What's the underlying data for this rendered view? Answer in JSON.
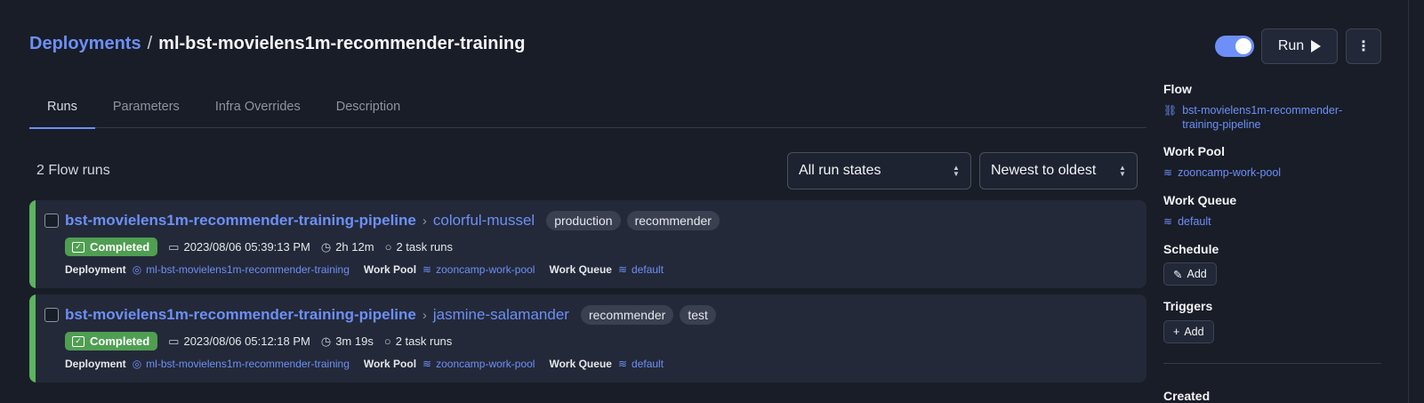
{
  "header": {
    "breadcrumb_root": "Deployments",
    "breadcrumb_sep": "/",
    "breadcrumb_current": "ml-bst-movielens1m-recommender-training",
    "run_label": "Run",
    "menu_glyph": "⋮"
  },
  "tabs": [
    {
      "label": "Runs",
      "active": true
    },
    {
      "label": "Parameters",
      "active": false
    },
    {
      "label": "Infra Overrides",
      "active": false
    },
    {
      "label": "Description",
      "active": false
    }
  ],
  "runs_count": "2 Flow runs",
  "filters": {
    "state_selected": "All run states",
    "sort_selected": "Newest to oldest"
  },
  "runs": [
    {
      "flow": "bst-movielens1m-recommender-training-pipeline",
      "name": "colorful-mussel",
      "tags": [
        "production",
        "recommender"
      ],
      "status": "Completed",
      "start": "2023/08/06 05:39:13 PM",
      "duration": "2h 12m",
      "task_runs": "2 task runs",
      "deployment_label": "Deployment",
      "deployment": "ml-bst-movielens1m-recommender-training",
      "work_pool_label": "Work Pool",
      "work_pool": "zooncamp-work-pool",
      "work_queue_label": "Work Queue",
      "work_queue": "default"
    },
    {
      "flow": "bst-movielens1m-recommender-training-pipeline",
      "name": "jasmine-salamander",
      "tags": [
        "recommender",
        "test"
      ],
      "status": "Completed",
      "start": "2023/08/06 05:12:18 PM",
      "duration": "3m 19s",
      "task_runs": "2 task runs",
      "deployment_label": "Deployment",
      "deployment": "ml-bst-movielens1m-recommender-training",
      "work_pool_label": "Work Pool",
      "work_pool": "zooncamp-work-pool",
      "work_queue_label": "Work Queue",
      "work_queue": "default"
    }
  ],
  "sidebar": {
    "flow_heading": "Flow",
    "flow_link_line1": "bst-movielens1m-recommender-",
    "flow_link_line2": "training-pipeline",
    "work_pool_heading": "Work Pool",
    "work_pool_link": "zooncamp-work-pool",
    "work_queue_heading": "Work Queue",
    "work_queue_link": "default",
    "schedule_heading": "Schedule",
    "schedule_add": "Add",
    "triggers_heading": "Triggers",
    "triggers_add": "Add",
    "created_heading": "Created"
  },
  "colors": {
    "accent": "#6d8ff7",
    "completed": "#4f9e52",
    "background": "#181d27",
    "card": "#232938"
  }
}
